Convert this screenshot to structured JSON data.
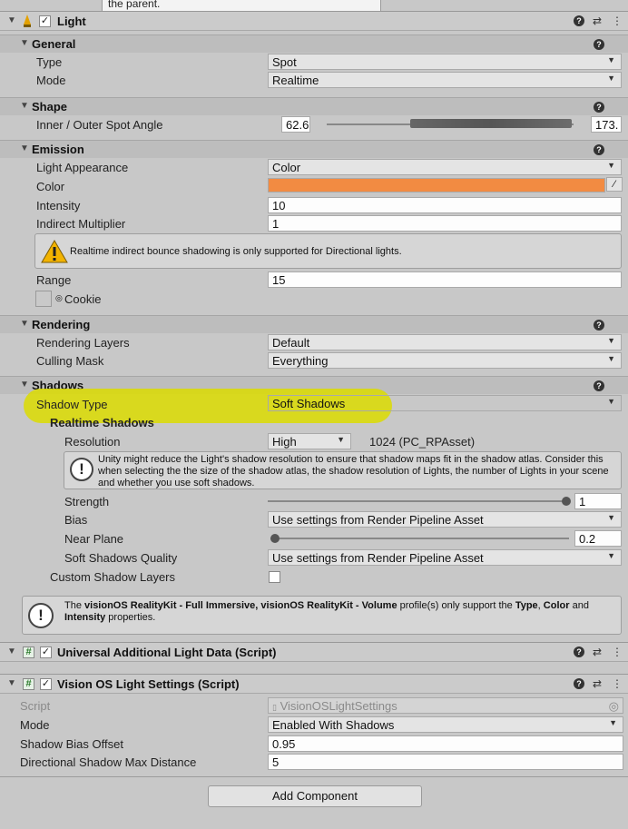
{
  "tooltip": "the parent.",
  "light": {
    "title": "Light",
    "general": {
      "title": "General",
      "type_label": "Type",
      "type_value": "Spot",
      "mode_label": "Mode",
      "mode_value": "Realtime"
    },
    "shape": {
      "title": "Shape",
      "angle_label": "Inner / Outer Spot Angle",
      "inner_value": "62.6",
      "outer_value": "173."
    },
    "emission": {
      "title": "Emission",
      "appearance_label": "Light Appearance",
      "appearance_value": "Color",
      "color_label": "Color",
      "color_hex": "#f28b42",
      "intensity_label": "Intensity",
      "intensity_value": "10",
      "indirect_label": "Indirect Multiplier",
      "indirect_value": "1",
      "warning": "Realtime indirect bounce shadowing is only supported for Directional lights.",
      "range_label": "Range",
      "range_value": "15",
      "cookie_label": "Cookie"
    },
    "rendering": {
      "title": "Rendering",
      "layers_label": "Rendering Layers",
      "layers_value": "Default",
      "culling_label": "Culling Mask",
      "culling_value": "Everything"
    },
    "shadows": {
      "title": "Shadows",
      "type_label": "Shadow Type",
      "type_value": "Soft Shadows",
      "realtime_title": "Realtime Shadows",
      "resolution_label": "Resolution",
      "resolution_value": "High",
      "resolution_info": "1024 (PC_RPAsset)",
      "resolution_note": "Unity might reduce the Light's shadow resolution to ensure that shadow maps fit in the shadow atlas. Consider this when selecting the the size of the shadow atlas, the shadow resolution of Lights, the number of Lights in your scene and whether you use soft shadows.",
      "strength_label": "Strength",
      "strength_value": "1",
      "strength_fraction": 1.0,
      "bias_label": "Bias",
      "bias_value": "Use settings from Render Pipeline Asset",
      "near_label": "Near Plane",
      "near_value": "0.2",
      "near_fraction": 0.0,
      "quality_label": "Soft Shadows Quality",
      "quality_value": "Use settings from Render Pipeline Asset",
      "custom_label": "Custom Shadow Layers"
    },
    "visionos_note": {
      "t1": "The ",
      "b1": "visionOS RealityKit - Full Immersive, visionOS RealityKit - Volume",
      "t2": " profile(s) only support the ",
      "b2": "Type",
      "t3": ", ",
      "b3": "Color",
      "t4": " and",
      "b4": "Intensity",
      "t5": " properties."
    }
  },
  "universal": {
    "title": "Universal Additional Light Data (Script)"
  },
  "vision": {
    "title": "Vision OS Light Settings (Script)",
    "script_label": "Script",
    "script_value": "VisionOSLightSettings",
    "mode_label": "Mode",
    "mode_value": "Enabled With Shadows",
    "bias_label": "Shadow Bias Offset",
    "bias_value": "0.95",
    "maxdist_label": "Directional Shadow Max Distance",
    "maxdist_value": "5"
  },
  "add_component": "Add Component",
  "icons": {
    "help": "?",
    "preset": "⇄",
    "menu": "⋮",
    "foldout": "▼",
    "dropdown": "▼",
    "check": "✓",
    "warning": "!",
    "info": "!",
    "eyedropper": "⁄",
    "script": "#",
    "target": "◎",
    "light_icon": "♟"
  },
  "colors": {
    "highlight": "#dcdc00",
    "color_swatch": "#f28b42"
  }
}
